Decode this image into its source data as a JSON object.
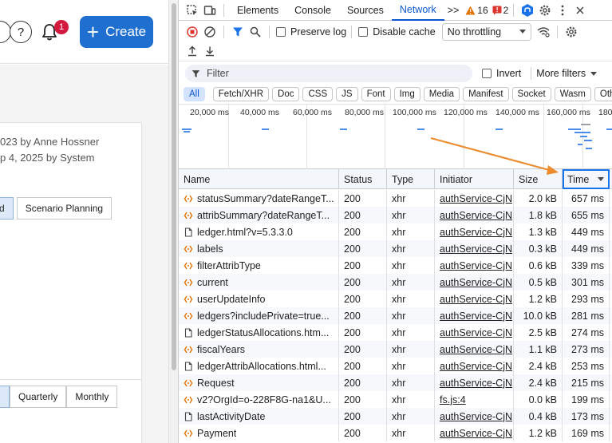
{
  "app": {
    "help_glyph": "?",
    "notification_count": "1",
    "create_label": "Create",
    "meta_line_1": "023 by Anne Hossner",
    "meta_line_2": "p 4, 2025 by System",
    "view_options": [
      "d",
      "Scenario Planning"
    ],
    "period_options": [
      "",
      "Quarterly",
      "Monthly"
    ]
  },
  "devtools": {
    "tabs": [
      "Elements",
      "Console",
      "Sources",
      "Network"
    ],
    "active_tab": "Network",
    "more_tabs_glyph": ">>",
    "warning_count": "16",
    "error_count": "2",
    "preserve_log_label": "Preserve log",
    "disable_cache_label": "Disable cache",
    "throttling_value": "No throttling",
    "filter_placeholder": "Filter",
    "invert_label": "Invert",
    "more_filters_label": "More filters",
    "type_filters": [
      "All",
      "Fetch/XHR",
      "Doc",
      "CSS",
      "JS",
      "Font",
      "Img",
      "Media",
      "Manifest",
      "Socket",
      "Wasm",
      "Other"
    ],
    "active_type_filter": "All",
    "overview_labels": [
      "20,000 ms",
      "40,000 ms",
      "60,000 ms",
      "80,000 ms",
      "100,000 ms",
      "120,000 ms",
      "140,000 ms",
      "160,000 ms",
      "180"
    ],
    "columns": [
      "Name",
      "Status",
      "Type",
      "Initiator",
      "Size",
      "Time"
    ],
    "sorted_column": "Time",
    "rows": [
      {
        "name": "statusSummary?dateRangeT...",
        "status": "200",
        "type": "xhr",
        "initiator": "authService-CjN",
        "size": "2.0 kB",
        "time": "657 ms",
        "icon": "xhr"
      },
      {
        "name": "attribSummary?dateRangeT...",
        "status": "200",
        "type": "xhr",
        "initiator": "authService-CjN",
        "size": "1.8 kB",
        "time": "655 ms",
        "icon": "xhr"
      },
      {
        "name": "ledger.html?v=5.3.3.0",
        "status": "200",
        "type": "xhr",
        "initiator": "authService-CjN",
        "size": "1.3 kB",
        "time": "449 ms",
        "icon": "doc"
      },
      {
        "name": "labels",
        "status": "200",
        "type": "xhr",
        "initiator": "authService-CjN",
        "size": "0.3 kB",
        "time": "449 ms",
        "icon": "xhr"
      },
      {
        "name": "filterAttribType",
        "status": "200",
        "type": "xhr",
        "initiator": "authService-CjN",
        "size": "0.6 kB",
        "time": "339 ms",
        "icon": "xhr"
      },
      {
        "name": "current",
        "status": "200",
        "type": "xhr",
        "initiator": "authService-CjN",
        "size": "0.5 kB",
        "time": "301 ms",
        "icon": "xhr"
      },
      {
        "name": "userUpdateInfo",
        "status": "200",
        "type": "xhr",
        "initiator": "authService-CjN",
        "size": "1.2 kB",
        "time": "293 ms",
        "icon": "xhr"
      },
      {
        "name": "ledgers?includePrivate=true...",
        "status": "200",
        "type": "xhr",
        "initiator": "authService-CjN",
        "size": "10.0 kB",
        "time": "281 ms",
        "icon": "xhr"
      },
      {
        "name": "ledgerStatusAllocations.htm...",
        "status": "200",
        "type": "xhr",
        "initiator": "authService-CjN",
        "size": "2.5 kB",
        "time": "274 ms",
        "icon": "doc"
      },
      {
        "name": "fiscalYears",
        "status": "200",
        "type": "xhr",
        "initiator": "authService-CjN",
        "size": "1.1 kB",
        "time": "273 ms",
        "icon": "xhr"
      },
      {
        "name": "ledgerAttribAllocations.html...",
        "status": "200",
        "type": "xhr",
        "initiator": "authService-CjN",
        "size": "2.4 kB",
        "time": "253 ms",
        "icon": "doc"
      },
      {
        "name": "Request",
        "status": "200",
        "type": "xhr",
        "initiator": "authService-CjN",
        "size": "2.4 kB",
        "time": "215 ms",
        "icon": "xhr"
      },
      {
        "name": "v2?OrgId=o-228F8G-na1&U...",
        "status": "200",
        "type": "xhr",
        "initiator": "fs.js:4",
        "size": "0.0 kB",
        "time": "199 ms",
        "icon": "xhr"
      },
      {
        "name": "lastActivityDate",
        "status": "200",
        "type": "xhr",
        "initiator": "authService-CjN",
        "size": "0.4 kB",
        "time": "173 ms",
        "icon": "doc"
      },
      {
        "name": "Payment",
        "status": "200",
        "type": "xhr",
        "initiator": "authService-CjN",
        "size": "1.2 kB",
        "time": "169 ms",
        "icon": "xhr"
      }
    ]
  }
}
